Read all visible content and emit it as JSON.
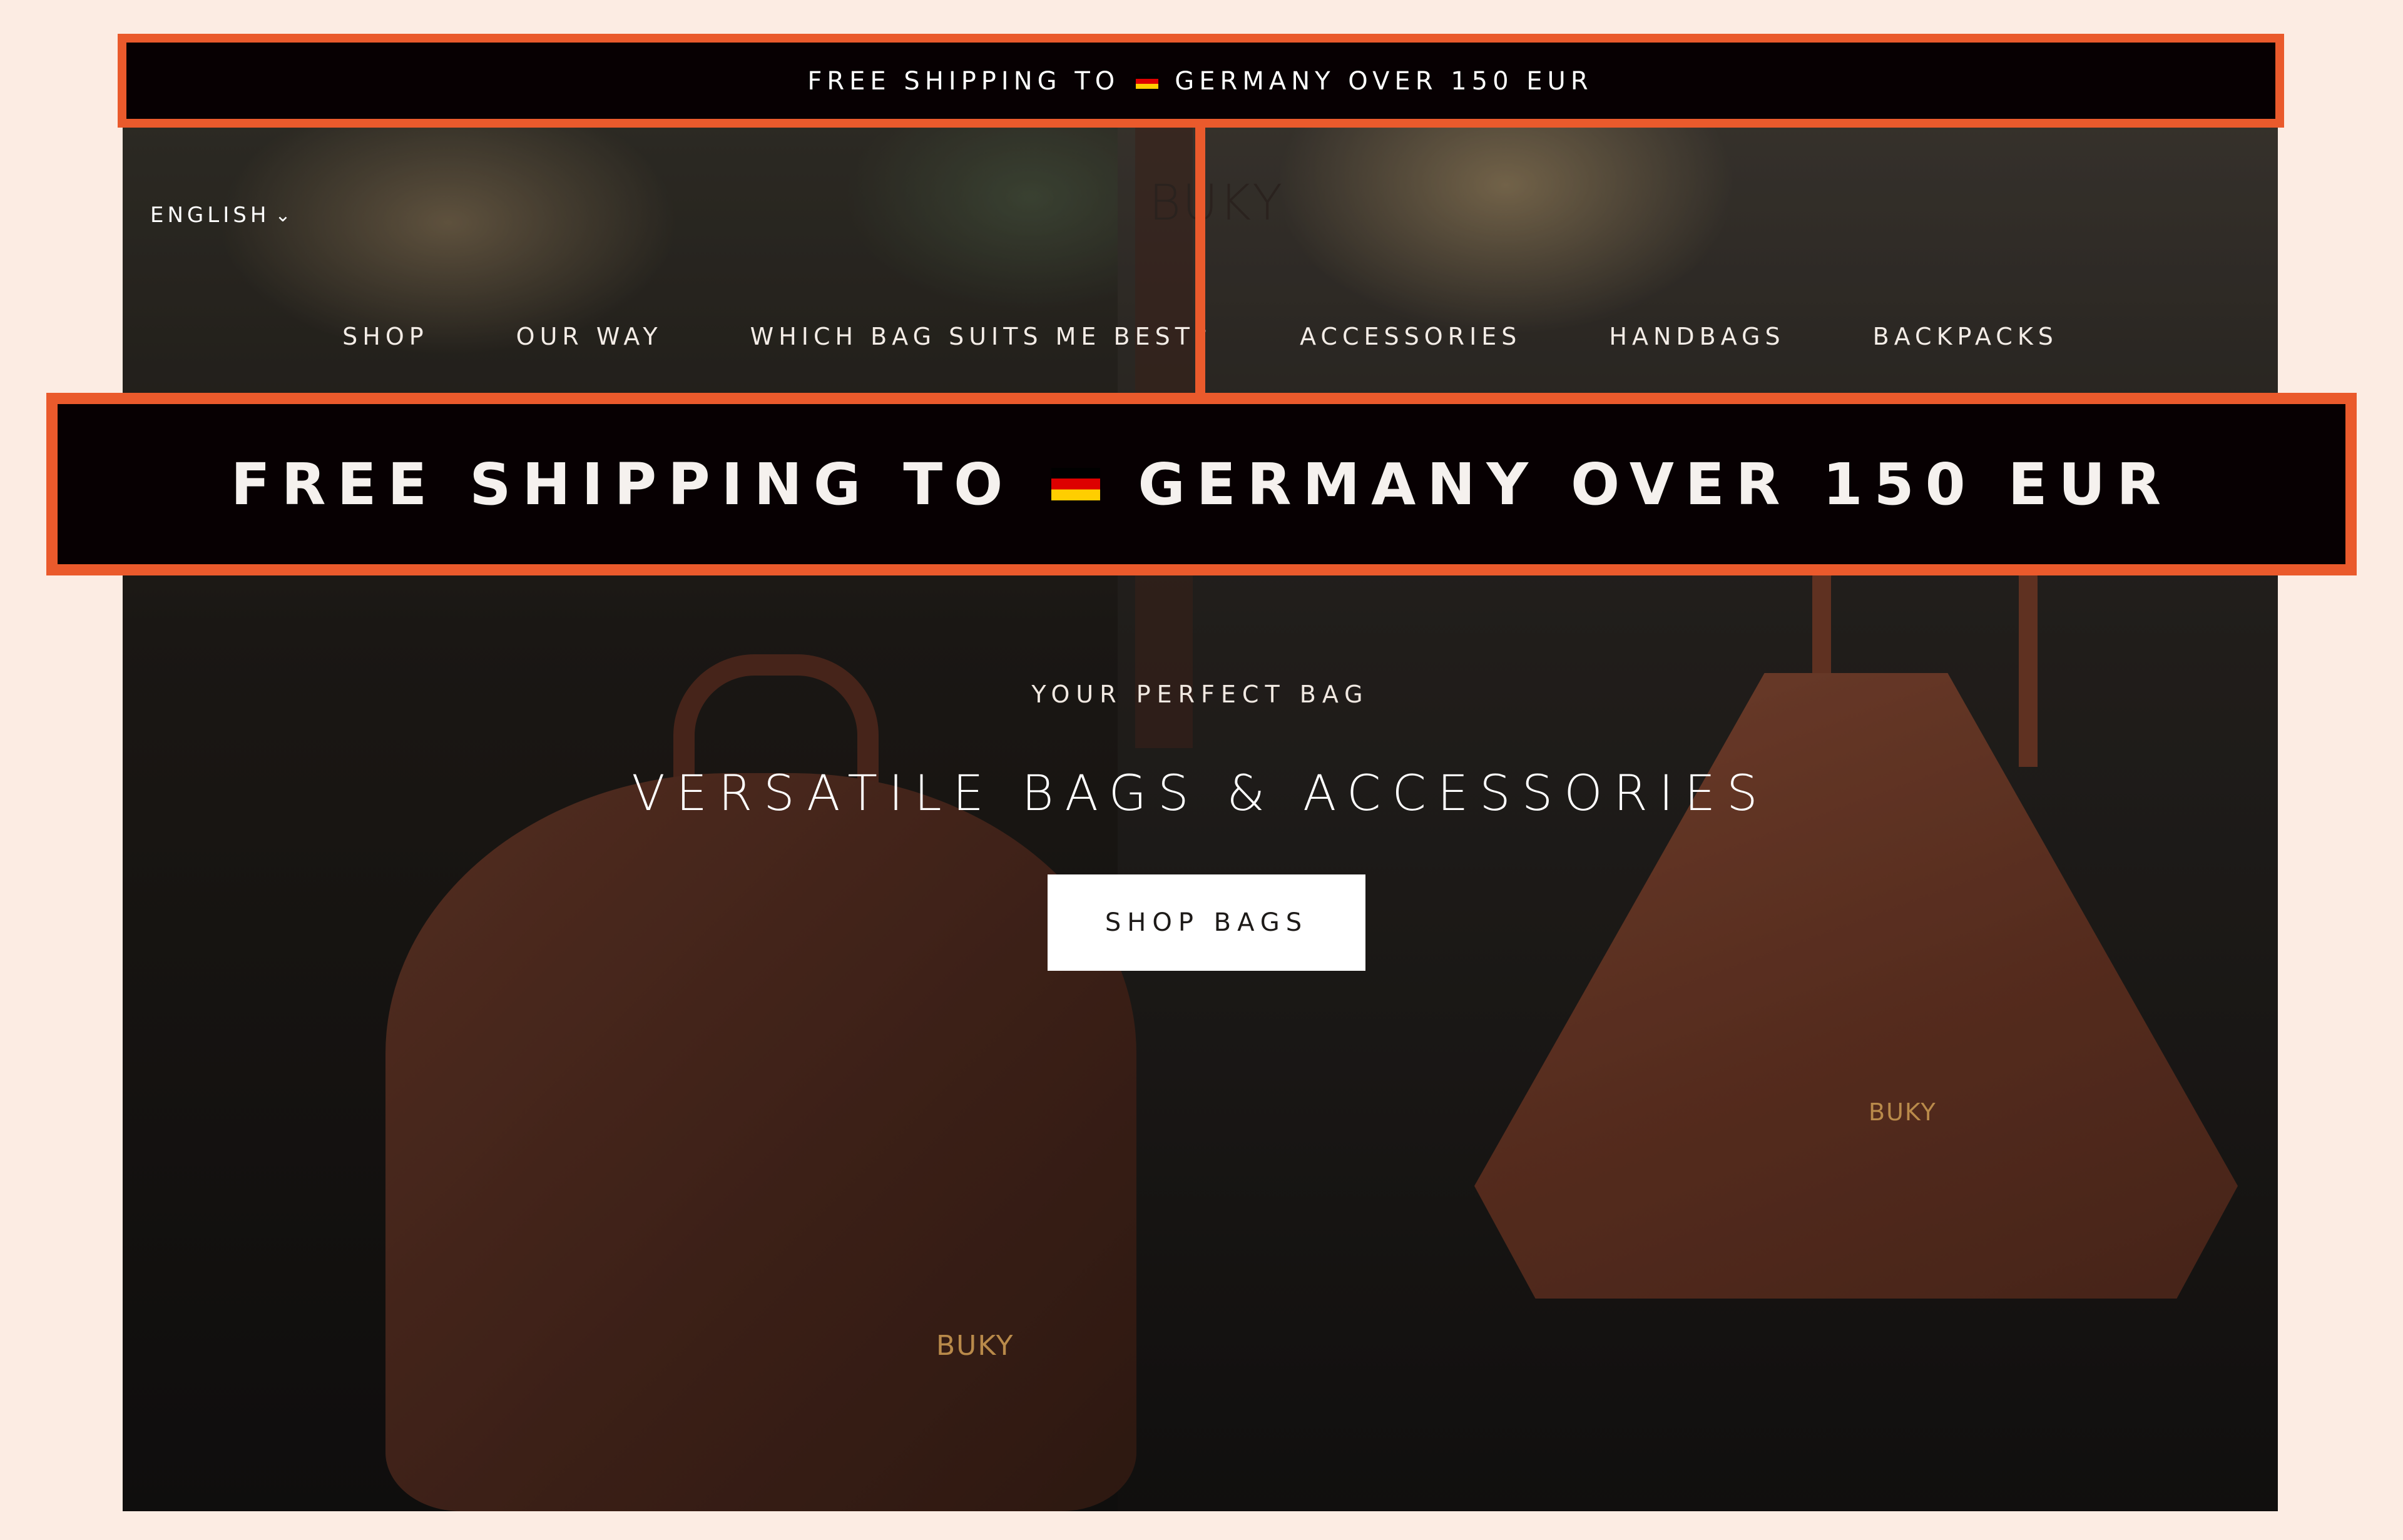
{
  "announcement": {
    "text_before_flag": "FREE SHIPPING TO",
    "text_after_flag": "GERMANY OVER 150 EUR",
    "flag_icon": "germany-flag-icon"
  },
  "header": {
    "language": "ENGLISH",
    "language_icon": "chevron-down-icon",
    "logo": "BUKY"
  },
  "nav": {
    "items": [
      {
        "label": "SHOP"
      },
      {
        "label": "OUR WAY"
      },
      {
        "label": "WHICH BAG SUITS ME BEST?"
      },
      {
        "label": "ACCESSORIES"
      },
      {
        "label": "HANDBAGS"
      },
      {
        "label": "BACKPACKS"
      }
    ]
  },
  "hero": {
    "eyebrow": "YOUR PERFECT BAG",
    "headline": "VERSATILE BAGS & ACCESSORIES",
    "cta_label": "SHOP BAGS",
    "bag_logo_left": "BUKY",
    "bag_logo_right": "BUKY"
  },
  "colors": {
    "highlight": "#ea5a2c",
    "bar_bg": "#070002",
    "page_bg": "#fcece3"
  }
}
